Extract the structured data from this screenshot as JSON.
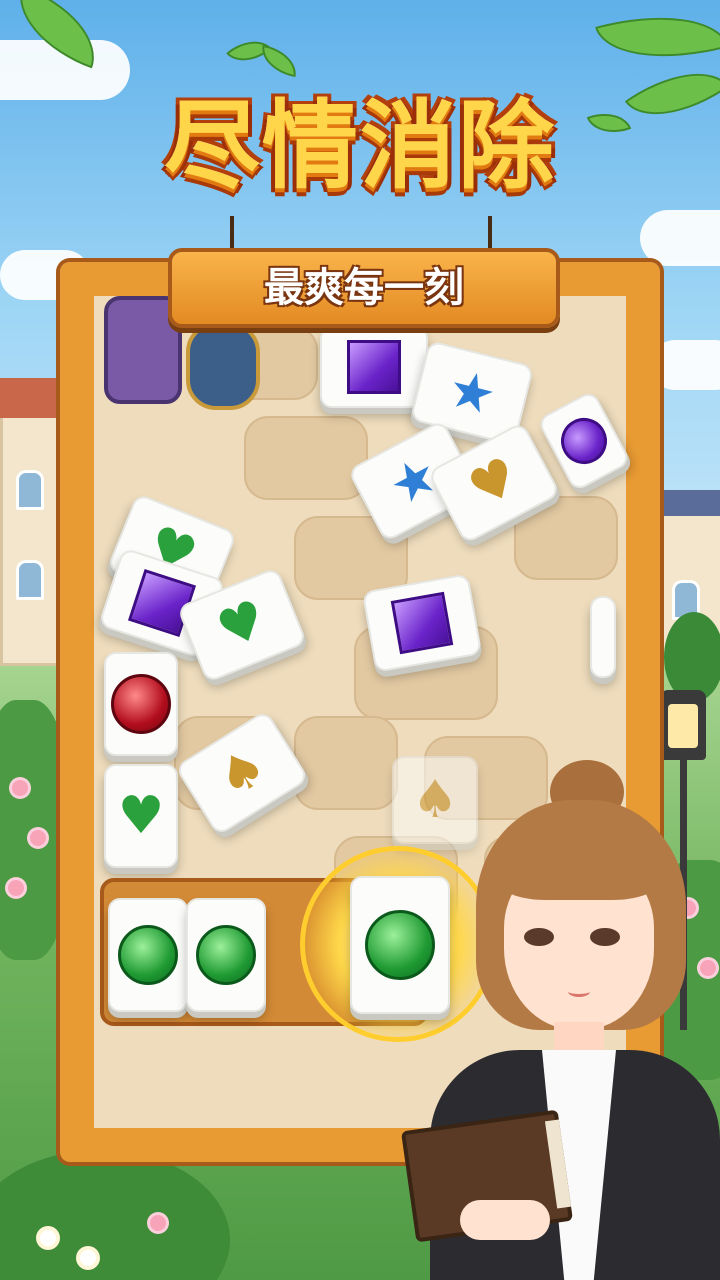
{
  "promo": {
    "headline": "尽情消除",
    "tagline": "最爽每一刻"
  },
  "board": {
    "tiles": [
      {
        "symbol": "purple-square-gem"
      },
      {
        "symbol": "blue-star"
      },
      {
        "symbol": "blue-star"
      },
      {
        "symbol": "gold-heart"
      },
      {
        "symbol": "purple-round-gem"
      },
      {
        "symbol": "green-heart"
      },
      {
        "symbol": "purple-square-gem"
      },
      {
        "symbol": "green-heart"
      },
      {
        "symbol": "purple-square-gem"
      },
      {
        "symbol": "red-round-gem"
      },
      {
        "symbol": "green-heart"
      },
      {
        "symbol": "gold-spade"
      },
      {
        "symbol": "gold-spade"
      }
    ],
    "tray": [
      {
        "symbol": "green-round-gem"
      },
      {
        "symbol": "green-round-gem"
      }
    ],
    "selected_tile": {
      "symbol": "green-round-gem"
    }
  },
  "colors": {
    "frame": "#e89a33",
    "sign": "#f2a23c",
    "title": "#ffd54a",
    "glow": "#ffd84a"
  }
}
